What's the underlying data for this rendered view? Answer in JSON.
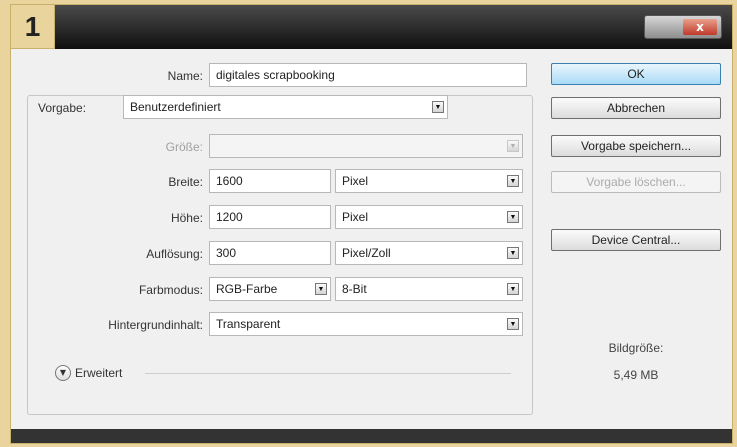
{
  "title_bar": {
    "step": "1",
    "close_label": "x"
  },
  "form": {
    "name": {
      "label": "Name:",
      "value": "digitales scrapbooking"
    },
    "vorgabe": {
      "label": "Vorgabe:",
      "value": "Benutzerdefiniert"
    },
    "groesse": {
      "label": "Größe:",
      "value": ""
    },
    "breite": {
      "label": "Breite:",
      "value": "1600",
      "unit": "Pixel"
    },
    "hoehe": {
      "label": "Höhe:",
      "value": "1200",
      "unit": "Pixel"
    },
    "aufloesung": {
      "label": "Auflösung:",
      "value": "300",
      "unit": "Pixel/Zoll"
    },
    "farbmodus": {
      "label": "Farbmodus:",
      "mode": "RGB-Farbe",
      "depth": "8-Bit"
    },
    "hintergrund": {
      "label": "Hintergrundinhalt:",
      "value": "Transparent"
    },
    "erweitert": {
      "label": "Erweitert"
    }
  },
  "buttons": {
    "ok": "OK",
    "abbrechen": "Abbrechen",
    "vorgabe_speichern": "Vorgabe speichern...",
    "vorgabe_loeschen": "Vorgabe löschen...",
    "device_central": "Device Central..."
  },
  "info": {
    "label": "Bildgröße:",
    "value": "5,49 MB"
  },
  "colors": {
    "accent": "#a9dbf6",
    "frame": "#e8d49c",
    "titlebar": "#101010"
  }
}
